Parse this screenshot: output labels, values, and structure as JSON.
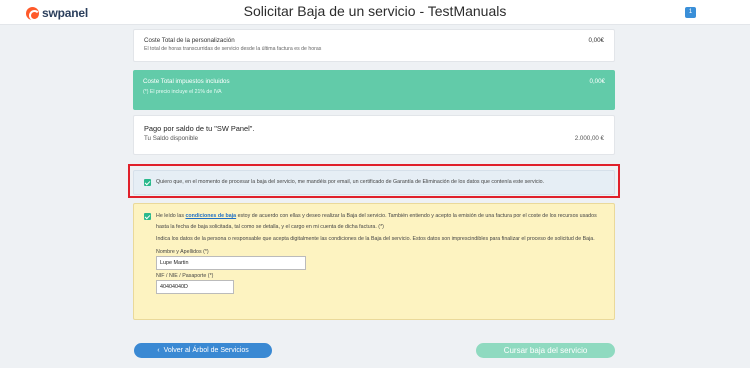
{
  "header": {
    "logo_text": "swpanel",
    "title": "Solicitar Baja de un servicio - TestManuals",
    "user_badge": "1"
  },
  "personalization": {
    "label": "Coste Total de la personalización",
    "description": "El total de horas transcurridas de servicio desde la última factura es de horas",
    "amount": "0,00€"
  },
  "total": {
    "label": "Coste Total impuestos incluidos",
    "note": "(*) El precio incluye el 21% de IVA",
    "amount": "0,00€"
  },
  "balance": {
    "heading": "Pago por saldo de tu \"SW Panel\".",
    "label": "Tu Saldo disponible",
    "amount": "2.000,00 €"
  },
  "certificate": {
    "text": "Quiero que, en el momento de procesar la baja del servicio, me mandéis por email, un certificado de Garantía de Eliminación de los datos que contenía este servicio."
  },
  "terms": {
    "pre_link": "He leído las",
    "link": "condiciones de baja",
    "post_link": "estoy de acuerdo con ellas y deseo realizar la Baja del servicio. También entiendo y acepto la emisión de una factura por el coste de los recursos usados hasta la fecha de baja solicitada, tal como se detalla, y el cargo en mi cuenta de dicha factura. (*)",
    "info": "Indica los datos de la persona o responsable que acepta digitalmente las condiciones de la Baja del servicio. Estos datos son imprescindibles para finalizar el proceso de solicitud de Baja.",
    "name_label": "Nombre y Apellidos (*)",
    "name_value": "Lupe Martin",
    "id_label": "NIF / NIE / Pasaporte (*)",
    "id_value": "40404040D"
  },
  "buttons": {
    "back": "Volver al Árbol de Servicios",
    "submit": "Cursar baja del servicio"
  },
  "colors": {
    "accent_green": "#62cba9",
    "accent_blue": "#3a89d3",
    "highlight_red": "#e0202a"
  }
}
